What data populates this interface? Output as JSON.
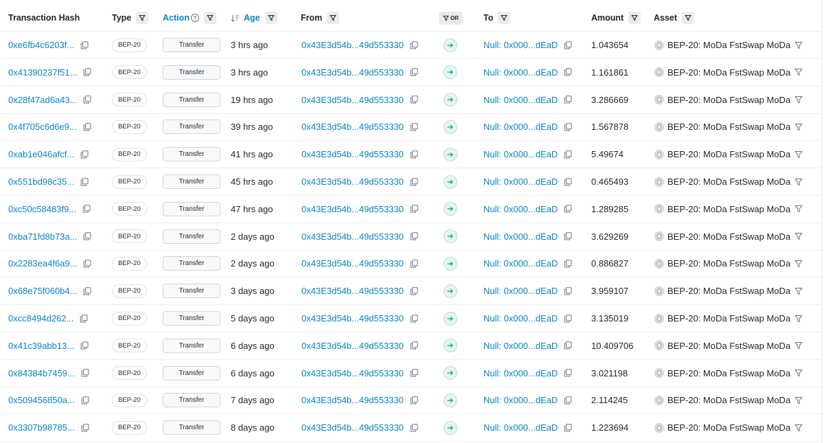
{
  "headers": {
    "hash": "Transaction Hash",
    "type": "Type",
    "action": "Action",
    "action_help": "?",
    "age": "Age",
    "from": "From",
    "or": "OR",
    "to": "To",
    "amount": "Amount",
    "asset": "Asset"
  },
  "rows": [
    {
      "hash": "0xe6fb4c6203f...",
      "type": "BEP-20",
      "action": "Transfer",
      "age": "3 hrs ago",
      "from": "0x43E3d54b...49d553330",
      "to": "Null: 0x000...dEaD",
      "amount": "1.043654",
      "asset": "BEP-20: MoDa FstSwap MoDa"
    },
    {
      "hash": "0x41390237f51...",
      "type": "BEP-20",
      "action": "Transfer",
      "age": "3 hrs ago",
      "from": "0x43E3d54b...49d553330",
      "to": "Null: 0x000...dEaD",
      "amount": "1.161861",
      "asset": "BEP-20: MoDa FstSwap MoDa"
    },
    {
      "hash": "0x28f47ad6a43...",
      "type": "BEP-20",
      "action": "Transfer",
      "age": "19 hrs ago",
      "from": "0x43E3d54b...49d553330",
      "to": "Null: 0x000...dEaD",
      "amount": "3.286669",
      "asset": "BEP-20: MoDa FstSwap MoDa"
    },
    {
      "hash": "0x4f705c6d6e9...",
      "type": "BEP-20",
      "action": "Transfer",
      "age": "39 hrs ago",
      "from": "0x43E3d54b...49d553330",
      "to": "Null: 0x000...dEaD",
      "amount": "1.567878",
      "asset": "BEP-20: MoDa FstSwap MoDa"
    },
    {
      "hash": "0xab1e046afcf...",
      "type": "BEP-20",
      "action": "Transfer",
      "age": "41 hrs ago",
      "from": "0x43E3d54b...49d553330",
      "to": "Null: 0x000...dEaD",
      "amount": "5.49674",
      "asset": "BEP-20: MoDa FstSwap MoDa"
    },
    {
      "hash": "0x551bd98c35...",
      "type": "BEP-20",
      "action": "Transfer",
      "age": "45 hrs ago",
      "from": "0x43E3d54b...49d553330",
      "to": "Null: 0x000...dEaD",
      "amount": "0.465493",
      "asset": "BEP-20: MoDa FstSwap MoDa"
    },
    {
      "hash": "0xc50c58483f9...",
      "type": "BEP-20",
      "action": "Transfer",
      "age": "47 hrs ago",
      "from": "0x43E3d54b...49d553330",
      "to": "Null: 0x000...dEaD",
      "amount": "1.289285",
      "asset": "BEP-20: MoDa FstSwap MoDa"
    },
    {
      "hash": "0xba71fd8b73a...",
      "type": "BEP-20",
      "action": "Transfer",
      "age": "2 days ago",
      "from": "0x43E3d54b...49d553330",
      "to": "Null: 0x000...dEaD",
      "amount": "3.629269",
      "asset": "BEP-20: MoDa FstSwap MoDa"
    },
    {
      "hash": "0x2283ea4f6a9...",
      "type": "BEP-20",
      "action": "Transfer",
      "age": "2 days ago",
      "from": "0x43E3d54b...49d553330",
      "to": "Null: 0x000...dEaD",
      "amount": "0.886827",
      "asset": "BEP-20: MoDa FstSwap MoDa"
    },
    {
      "hash": "0x68e75f060b4...",
      "type": "BEP-20",
      "action": "Transfer",
      "age": "3 days ago",
      "from": "0x43E3d54b...49d553330",
      "to": "Null: 0x000...dEaD",
      "amount": "3.959107",
      "asset": "BEP-20: MoDa FstSwap MoDa"
    },
    {
      "hash": "0xcc8494d262...",
      "type": "BEP-20",
      "action": "Transfer",
      "age": "5 days ago",
      "from": "0x43E3d54b...49d553330",
      "to": "Null: 0x000...dEaD",
      "amount": "3.135019",
      "asset": "BEP-20: MoDa FstSwap MoDa"
    },
    {
      "hash": "0x41c39abb13...",
      "type": "BEP-20",
      "action": "Transfer",
      "age": "6 days ago",
      "from": "0x43E3d54b...49d553330",
      "to": "Null: 0x000...dEaD",
      "amount": "10.409706",
      "asset": "BEP-20: MoDa FstSwap MoDa"
    },
    {
      "hash": "0x84384b7459...",
      "type": "BEP-20",
      "action": "Transfer",
      "age": "6 days ago",
      "from": "0x43E3d54b...49d553330",
      "to": "Null: 0x000...dEaD",
      "amount": "3.021198",
      "asset": "BEP-20: MoDa FstSwap MoDa"
    },
    {
      "hash": "0x509456850a...",
      "type": "BEP-20",
      "action": "Transfer",
      "age": "7 days ago",
      "from": "0x43E3d54b...49d553330",
      "to": "Null: 0x000...dEaD",
      "amount": "2.114245",
      "asset": "BEP-20: MoDa FstSwap MoDa"
    },
    {
      "hash": "0x3307b98785...",
      "type": "BEP-20",
      "action": "Transfer",
      "age": "8 days ago",
      "from": "0x43E3d54b...49d553330",
      "to": "Null: 0x000...dEaD",
      "amount": "1.223694",
      "asset": "BEP-20: MoDa FstSwap MoDa"
    }
  ],
  "icons": {
    "copy": "copy-icon",
    "filter": "funnel-icon",
    "direction": "arrow-right-icon",
    "token": "token-logo-icon"
  },
  "colors": {
    "link": "#0784c3",
    "arrow_bg": "#e6f5ef",
    "arrow_fg": "#00a186"
  }
}
